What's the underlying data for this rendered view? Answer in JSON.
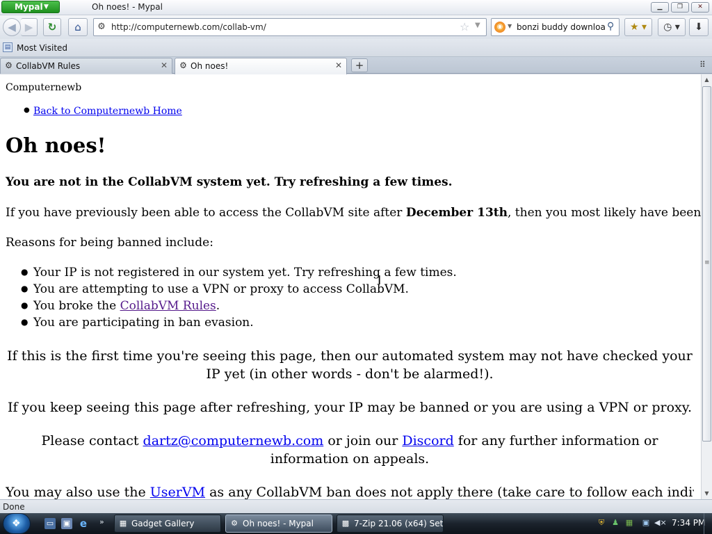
{
  "window": {
    "app_button": "Mypal",
    "title": "Oh noes! - Mypal"
  },
  "navbar": {
    "url": "http://computernewb.com/collab-vm/",
    "search_value": "bonzi buddy download"
  },
  "bookmarks_bar": {
    "items": [
      {
        "label": "Most Visited"
      }
    ]
  },
  "tabs": [
    {
      "label": "CollabVM Rules",
      "active": false
    },
    {
      "label": "Oh noes!",
      "active": true
    }
  ],
  "page": {
    "site_name": "Computernewb",
    "home_link": "Back to Computernewb Home",
    "heading": "Oh noes!",
    "notice": "You are not in the CollabVM system yet. Try refreshing a few times.",
    "previous_access": {
      "before": "If you have previously been able to access the CollabVM site after ",
      "bold": "December 13th",
      "after": ", then you most likely have been banned."
    },
    "reasons_intro": "Reasons for being banned include:",
    "reasons": [
      {
        "text": "Your IP is not registered in our system yet. Try refreshing a few times."
      },
      {
        "text": "You are attempting to use a VPN or proxy to access CollabVM."
      },
      {
        "before": "You broke the ",
        "link": "CollabVM Rules",
        "after": "."
      },
      {
        "text": "You are participating in ban evasion."
      }
    ],
    "first_time": "If this is the first time you're seeing this page, then our automated system may not have checked your IP yet (in other words - don't be alarmed!).",
    "keep_seeing": "If you keep seeing this page after refreshing, your IP may be banned or you are using a VPN or proxy.",
    "contact": {
      "before": "Please contact ",
      "email": "dartz@computernewb.com",
      "middle": " or join our ",
      "discord": "Discord",
      "after": " for any further information or information on appeals."
    },
    "uservm": {
      "before": "You may also use the ",
      "link": "UserVM",
      "after": " as any CollabVM ban does not apply there (take care to follow each individual"
    }
  },
  "status": {
    "text": "Done"
  },
  "taskbar": {
    "tasks": [
      {
        "label": "Gadget Gallery",
        "active": false
      },
      {
        "label": "Oh noes! - Mypal",
        "active": true
      },
      {
        "label": "7-Zip 21.06 (x64) Set...",
        "active": false
      }
    ],
    "clock": "7:34 PM"
  },
  "colors": {
    "link": "#0000ee",
    "visited_link": "#551a8b",
    "app_button": "#1e8f1e"
  }
}
